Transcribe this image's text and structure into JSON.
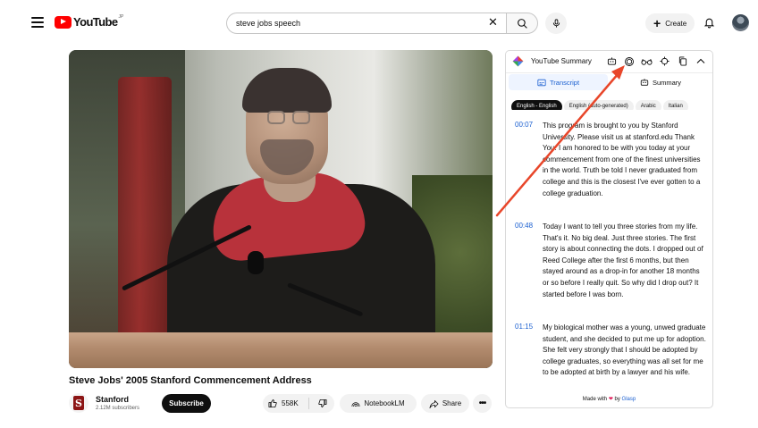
{
  "header": {
    "menu_icon": "hamburger-menu-icon",
    "logo_text": "YouTube",
    "logo_region": "JP",
    "search_value": "steve jobs speech",
    "create_label": "Create"
  },
  "video": {
    "title": "Steve Jobs' 2005 Stanford Commencement Address",
    "channel_name": "Stanford",
    "channel_subscribers": "2.12M subscribers",
    "subscribe_label": "Subscribe",
    "like_count": "558K",
    "notebooklm_label": "NotebookLM",
    "share_label": "Share",
    "more_label": "•••"
  },
  "panel": {
    "title": "YouTube Summary",
    "tabs": {
      "transcript": "Transcript",
      "summary": "Summary"
    },
    "languages": [
      "English - English",
      "English (auto-generated)",
      "Arabic",
      "Italian"
    ],
    "transcript": [
      {
        "time": "00:07",
        "text": "This program is brought to you by Stanford University. Please visit us at stanford.edu Thank You. I am honored to be with you today at your commencement from one of the finest universities in the world. Truth be told I never graduated from college and this is the closest I've ever gotten to a college graduation."
      },
      {
        "time": "00:48",
        "text": "Today I want to tell you three stories from my life. That's it. No big deal. Just three stories. The first story is about connecting the dots. I dropped out of Reed College after the first 6 months, but then stayed around as a drop-in for another 18 months or so before I really quit. So why did I drop out? It started before I was born."
      },
      {
        "time": "01:15",
        "text": "My biological mother was a young, unwed graduate student, and she decided to put me up for adoption. She felt very strongly that I should be adopted by college graduates, so everything was all set for me to be adopted at birth by a lawyer and his wife."
      }
    ],
    "footer_made": "Made with",
    "footer_by": "by",
    "footer_brand": "Glasp"
  },
  "colors": {
    "brand_red": "#ff0000",
    "accent_blue": "#1a5fd0",
    "annotation_arrow": "#e8462a"
  }
}
